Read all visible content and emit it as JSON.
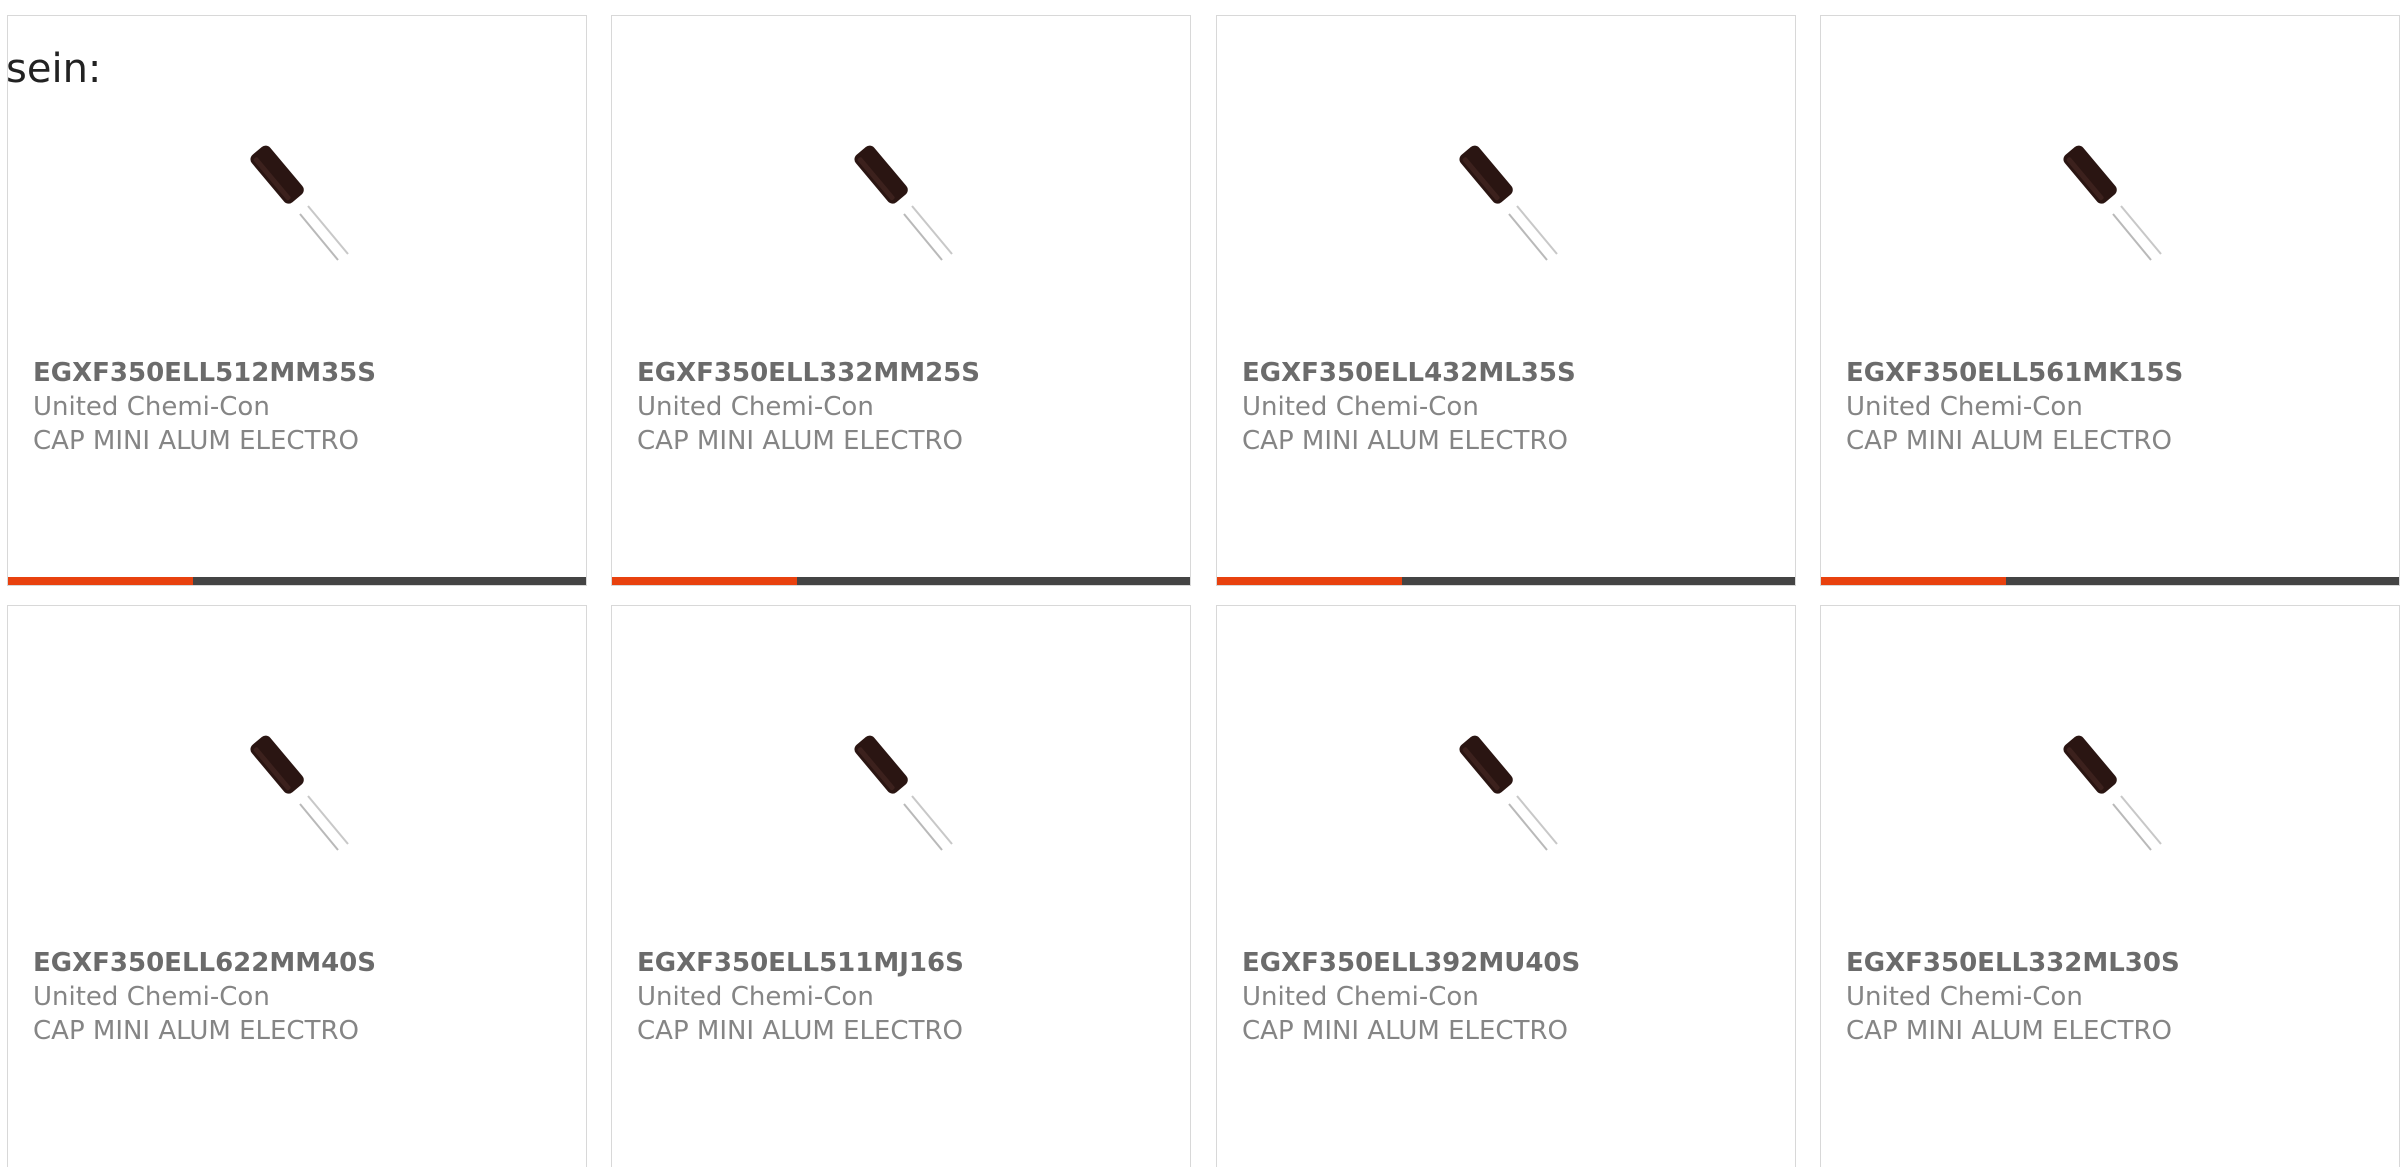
{
  "heading": "sein:",
  "colors": {
    "accent": "#e8410e",
    "bar_track": "#444444",
    "border": "#d8d8d8"
  },
  "products": [
    {
      "part_number": "EGXF350ELL512MM35S",
      "manufacturer": "United Chemi-Con",
      "description": "CAP MINI ALUM ELECTRO",
      "image": "capacitor-icon",
      "progress_fraction": 0.32
    },
    {
      "part_number": "EGXF350ELL332MM25S",
      "manufacturer": "United Chemi-Con",
      "description": "CAP MINI ALUM ELECTRO",
      "image": "capacitor-icon",
      "progress_fraction": 0.32
    },
    {
      "part_number": "EGXF350ELL432ML35S",
      "manufacturer": "United Chemi-Con",
      "description": "CAP MINI ALUM ELECTRO",
      "image": "capacitor-icon",
      "progress_fraction": 0.32
    },
    {
      "part_number": "EGXF350ELL561MK15S",
      "manufacturer": "United Chemi-Con",
      "description": "CAP MINI ALUM ELECTRO",
      "image": "capacitor-icon",
      "progress_fraction": 0.32
    },
    {
      "part_number": "EGXF350ELL622MM40S",
      "manufacturer": "United Chemi-Con",
      "description": "CAP MINI ALUM ELECTRO",
      "image": "capacitor-icon"
    },
    {
      "part_number": "EGXF350ELL511MJ16S",
      "manufacturer": "United Chemi-Con",
      "description": "CAP MINI ALUM ELECTRO",
      "image": "capacitor-icon"
    },
    {
      "part_number": "EGXF350ELL392MU40S",
      "manufacturer": "United Chemi-Con",
      "description": "CAP MINI ALUM ELECTRO",
      "image": "capacitor-icon"
    },
    {
      "part_number": "EGXF350ELL332ML30S",
      "manufacturer": "United Chemi-Con",
      "description": "CAP MINI ALUM ELECTRO",
      "image": "capacitor-icon"
    }
  ]
}
